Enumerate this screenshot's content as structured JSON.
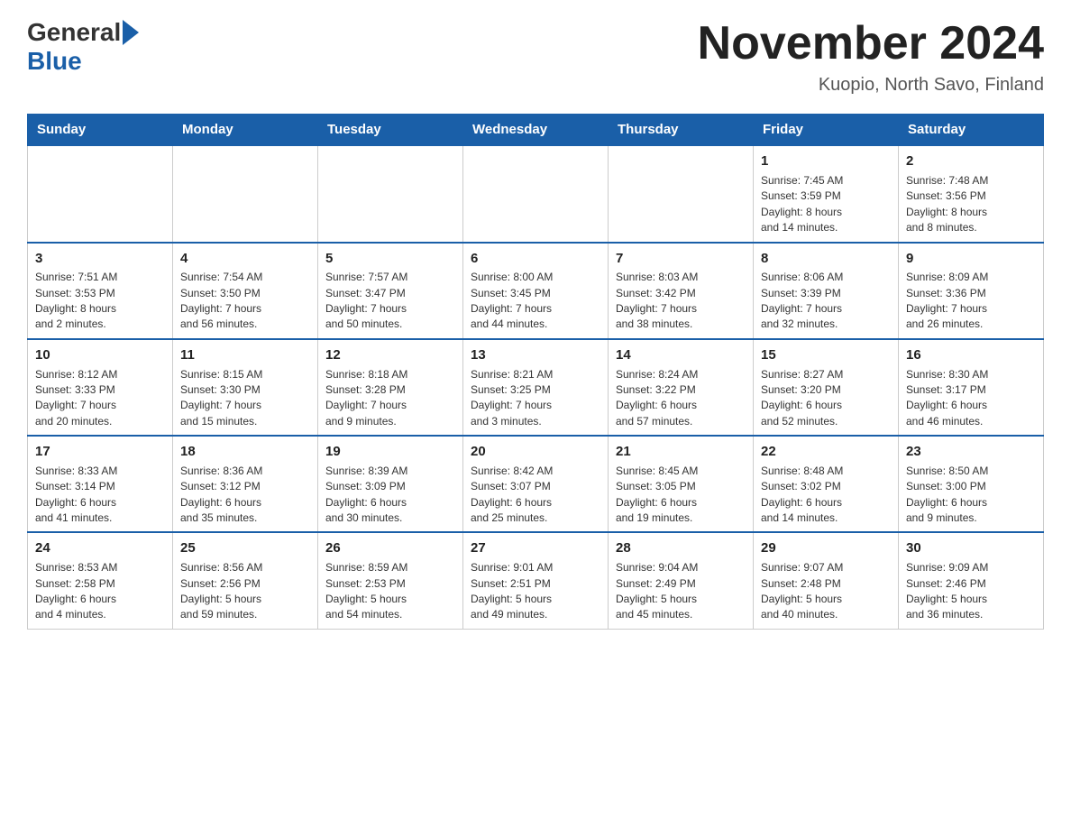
{
  "header": {
    "logo_general": "General",
    "logo_blue": "Blue",
    "month_title": "November 2024",
    "location": "Kuopio, North Savo, Finland"
  },
  "weekdays": [
    "Sunday",
    "Monday",
    "Tuesday",
    "Wednesday",
    "Thursday",
    "Friday",
    "Saturday"
  ],
  "weeks": [
    [
      {
        "day": "",
        "info": ""
      },
      {
        "day": "",
        "info": ""
      },
      {
        "day": "",
        "info": ""
      },
      {
        "day": "",
        "info": ""
      },
      {
        "day": "",
        "info": ""
      },
      {
        "day": "1",
        "info": "Sunrise: 7:45 AM\nSunset: 3:59 PM\nDaylight: 8 hours\nand 14 minutes."
      },
      {
        "day": "2",
        "info": "Sunrise: 7:48 AM\nSunset: 3:56 PM\nDaylight: 8 hours\nand 8 minutes."
      }
    ],
    [
      {
        "day": "3",
        "info": "Sunrise: 7:51 AM\nSunset: 3:53 PM\nDaylight: 8 hours\nand 2 minutes."
      },
      {
        "day": "4",
        "info": "Sunrise: 7:54 AM\nSunset: 3:50 PM\nDaylight: 7 hours\nand 56 minutes."
      },
      {
        "day": "5",
        "info": "Sunrise: 7:57 AM\nSunset: 3:47 PM\nDaylight: 7 hours\nand 50 minutes."
      },
      {
        "day": "6",
        "info": "Sunrise: 8:00 AM\nSunset: 3:45 PM\nDaylight: 7 hours\nand 44 minutes."
      },
      {
        "day": "7",
        "info": "Sunrise: 8:03 AM\nSunset: 3:42 PM\nDaylight: 7 hours\nand 38 minutes."
      },
      {
        "day": "8",
        "info": "Sunrise: 8:06 AM\nSunset: 3:39 PM\nDaylight: 7 hours\nand 32 minutes."
      },
      {
        "day": "9",
        "info": "Sunrise: 8:09 AM\nSunset: 3:36 PM\nDaylight: 7 hours\nand 26 minutes."
      }
    ],
    [
      {
        "day": "10",
        "info": "Sunrise: 8:12 AM\nSunset: 3:33 PM\nDaylight: 7 hours\nand 20 minutes."
      },
      {
        "day": "11",
        "info": "Sunrise: 8:15 AM\nSunset: 3:30 PM\nDaylight: 7 hours\nand 15 minutes."
      },
      {
        "day": "12",
        "info": "Sunrise: 8:18 AM\nSunset: 3:28 PM\nDaylight: 7 hours\nand 9 minutes."
      },
      {
        "day": "13",
        "info": "Sunrise: 8:21 AM\nSunset: 3:25 PM\nDaylight: 7 hours\nand 3 minutes."
      },
      {
        "day": "14",
        "info": "Sunrise: 8:24 AM\nSunset: 3:22 PM\nDaylight: 6 hours\nand 57 minutes."
      },
      {
        "day": "15",
        "info": "Sunrise: 8:27 AM\nSunset: 3:20 PM\nDaylight: 6 hours\nand 52 minutes."
      },
      {
        "day": "16",
        "info": "Sunrise: 8:30 AM\nSunset: 3:17 PM\nDaylight: 6 hours\nand 46 minutes."
      }
    ],
    [
      {
        "day": "17",
        "info": "Sunrise: 8:33 AM\nSunset: 3:14 PM\nDaylight: 6 hours\nand 41 minutes."
      },
      {
        "day": "18",
        "info": "Sunrise: 8:36 AM\nSunset: 3:12 PM\nDaylight: 6 hours\nand 35 minutes."
      },
      {
        "day": "19",
        "info": "Sunrise: 8:39 AM\nSunset: 3:09 PM\nDaylight: 6 hours\nand 30 minutes."
      },
      {
        "day": "20",
        "info": "Sunrise: 8:42 AM\nSunset: 3:07 PM\nDaylight: 6 hours\nand 25 minutes."
      },
      {
        "day": "21",
        "info": "Sunrise: 8:45 AM\nSunset: 3:05 PM\nDaylight: 6 hours\nand 19 minutes."
      },
      {
        "day": "22",
        "info": "Sunrise: 8:48 AM\nSunset: 3:02 PM\nDaylight: 6 hours\nand 14 minutes."
      },
      {
        "day": "23",
        "info": "Sunrise: 8:50 AM\nSunset: 3:00 PM\nDaylight: 6 hours\nand 9 minutes."
      }
    ],
    [
      {
        "day": "24",
        "info": "Sunrise: 8:53 AM\nSunset: 2:58 PM\nDaylight: 6 hours\nand 4 minutes."
      },
      {
        "day": "25",
        "info": "Sunrise: 8:56 AM\nSunset: 2:56 PM\nDaylight: 5 hours\nand 59 minutes."
      },
      {
        "day": "26",
        "info": "Sunrise: 8:59 AM\nSunset: 2:53 PM\nDaylight: 5 hours\nand 54 minutes."
      },
      {
        "day": "27",
        "info": "Sunrise: 9:01 AM\nSunset: 2:51 PM\nDaylight: 5 hours\nand 49 minutes."
      },
      {
        "day": "28",
        "info": "Sunrise: 9:04 AM\nSunset: 2:49 PM\nDaylight: 5 hours\nand 45 minutes."
      },
      {
        "day": "29",
        "info": "Sunrise: 9:07 AM\nSunset: 2:48 PM\nDaylight: 5 hours\nand 40 minutes."
      },
      {
        "day": "30",
        "info": "Sunrise: 9:09 AM\nSunset: 2:46 PM\nDaylight: 5 hours\nand 36 minutes."
      }
    ]
  ]
}
